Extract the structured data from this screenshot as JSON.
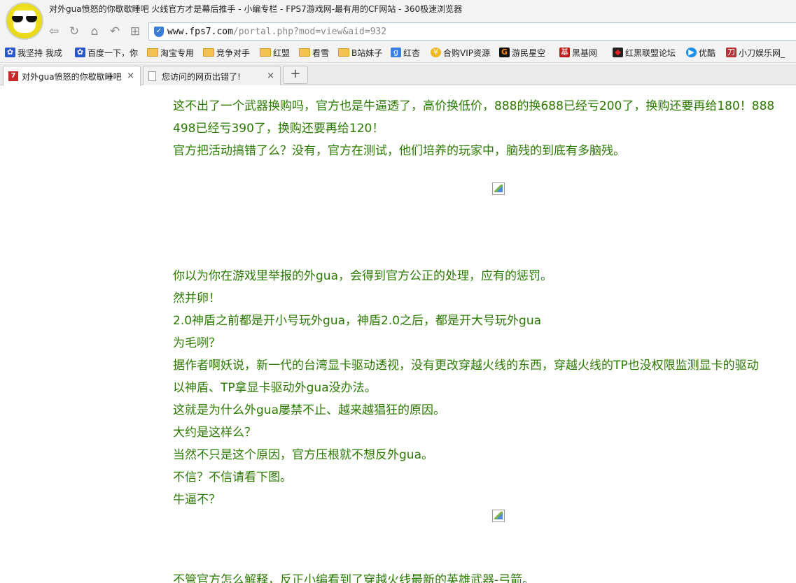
{
  "window": {
    "title": "对外gua愤怒的你歇歇睡吧  火线官方才是幕后推手 - 小编专栏 - FPS7游戏网-最有用的CF网站 - 360极速浏览器"
  },
  "addressbar": {
    "url_host": "www.fps7.com",
    "url_path": "/portal.php?mod=view&aid=932"
  },
  "bookmarks": [
    {
      "label": "我坚持 我成",
      "icon": "baidu-paw-icon"
    },
    {
      "label": "百度一下，你",
      "icon": "baidu-paw-icon"
    },
    {
      "label": "淘宝专用",
      "icon": "folder-icon"
    },
    {
      "label": "竞争对手",
      "icon": "folder-icon"
    },
    {
      "label": "红盟",
      "icon": "folder-icon"
    },
    {
      "label": "看雪",
      "icon": "folder-icon"
    },
    {
      "label": "B站妹子",
      "icon": "folder-icon"
    },
    {
      "label": "红杏",
      "icon": "g-icon"
    },
    {
      "label": "合购VIP资源",
      "icon": "coin-icon"
    },
    {
      "label": "游民星空",
      "icon": "gamersky-icon"
    },
    {
      "label": "黑基网",
      "icon": "heiji-icon"
    },
    {
      "label": "红黑联盟论坛",
      "icon": "shield-icon"
    },
    {
      "label": "优酷",
      "icon": "youku-play-icon"
    },
    {
      "label": "小刀娱乐网_",
      "icon": "xiaodao-icon"
    }
  ],
  "tabs": [
    {
      "label": "对外gua愤怒的你歇歇睡吧",
      "close": "×"
    },
    {
      "label": "您访问的网页出错了!",
      "close": "×"
    }
  ],
  "newtab_label": "+",
  "content": {
    "lines": [
      "这不出了一个武器换购吗，官方也是牛逼透了，高价换低价，888的换688已经亏200了，换购还要再给180！888",
      "498已经亏390了，换购还要再给120！",
      "官方把活动搞错了么？没有，官方在测试，他们培养的玩家中，脑残的到底有多脑残。",
      "你以为你在游戏里举报的外gua，会得到官方公正的处理，应有的惩罚。",
      "然并卵！",
      "2.0神盾之前都是开小号玩外gua，神盾2.0之后，都是开大号玩外gua",
      "为毛咧？",
      "据作者啊妖说，新一代的台湾显卡驱动透视，没有更改穿越火线的东西，穿越火线的TP也没权限监测显卡的驱动",
      "以神盾、TP拿显卡驱动外gua没办法。",
      "这就是为什么外gua屡禁不止、越来越猖狂的原因。",
      "大约是这样么？",
      "当然不只是这个原因，官方压根就不想反外gua。",
      "不信？不信请看下图。",
      "牛逼不？",
      "不管官方怎么解释，反正小编看到了穿越火线最新的英雄武器-弓箭。"
    ]
  }
}
